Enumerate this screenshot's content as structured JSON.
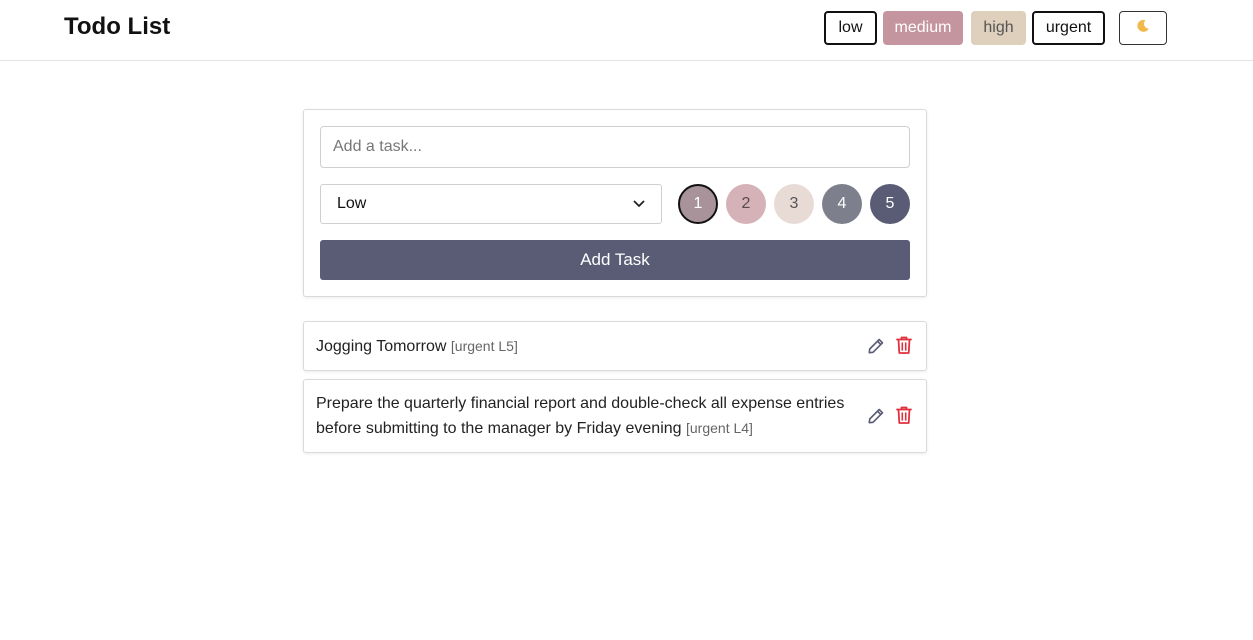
{
  "header": {
    "title": "Todo List",
    "filters": [
      {
        "label": "low",
        "color": "#ffffff"
      },
      {
        "label": "medium",
        "color": "#c4949f"
      },
      {
        "label": "high",
        "color": "#dfd0bd"
      },
      {
        "label": "urgent",
        "color": "#ffffff"
      }
    ],
    "theme_toggle_icon": "moon-icon"
  },
  "form": {
    "input_placeholder": "Add a task...",
    "input_value": "",
    "priority_selected": "Low",
    "levels": [
      {
        "label": "1",
        "color": "#a9939b",
        "selected": true
      },
      {
        "label": "2",
        "color": "#d4b2b8",
        "selected": false
      },
      {
        "label": "3",
        "color": "#e8dbd5",
        "selected": false
      },
      {
        "label": "4",
        "color": "#7d7f8c",
        "selected": false
      },
      {
        "label": "5",
        "color": "#5a5c75",
        "selected": false
      }
    ],
    "add_button_label": "Add Task",
    "add_button_color": "#5a5c75"
  },
  "tasks": [
    {
      "text": "Jogging Tomorrow",
      "meta": "[urgent L5]",
      "edit_icon": "pencil-icon",
      "delete_icon": "trash-icon"
    },
    {
      "text": "Prepare the quarterly financial report and double-check all expense entries before submitting to the manager by Friday evening",
      "meta": "[urgent L4]",
      "edit_icon": "pencil-icon",
      "delete_icon": "trash-icon"
    }
  ],
  "colors": {
    "delete": "#e0313f",
    "edit": "#5a5c75"
  }
}
